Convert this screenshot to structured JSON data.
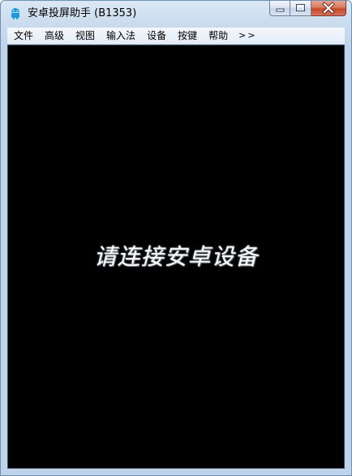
{
  "window": {
    "title": "安卓投屏助手 (B1353)",
    "icon": "android-icon",
    "accent_color": "#1e9bd8"
  },
  "caption": {
    "minimize_icon": "minimize-icon",
    "maximize_icon": "maximize-icon",
    "close_icon": "close-icon",
    "close_color": "#c3482b"
  },
  "menu": {
    "items": [
      {
        "label": "文件"
      },
      {
        "label": "高级"
      },
      {
        "label": "视图"
      },
      {
        "label": "输入法"
      },
      {
        "label": "设备"
      },
      {
        "label": "按键"
      },
      {
        "label": "帮助"
      }
    ],
    "overflow_label": ">>"
  },
  "screen": {
    "message": "请连接安卓设备",
    "background": "#000000"
  }
}
